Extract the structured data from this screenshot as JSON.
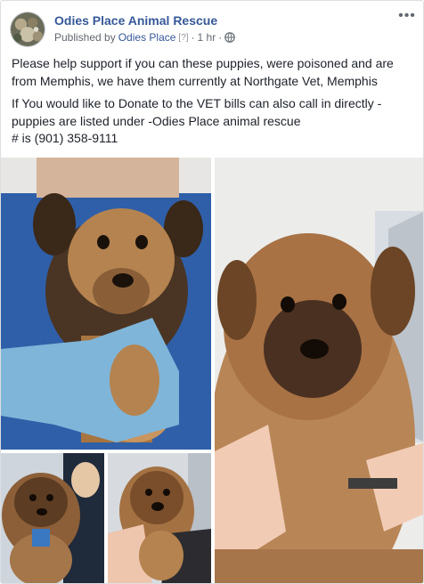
{
  "post": {
    "author": "Odies Place Animal Rescue",
    "published_by_prefix": "Published by",
    "published_by_name": "Odies Place",
    "help_marker": "[?]",
    "separator": "·",
    "timestamp": "1 hr",
    "more_icon": "more-options-icon",
    "privacy_icon": "globe-icon",
    "paragraphs": [
      "Please help support if you can these puppies, were poisoned and are from Memphis, we have them currently at Northgate Vet, Memphis",
      "If You would like to Donate to the VET bills can also call in directly - puppies are listed under -Odies Place animal rescue",
      "# is (901) 358-9111"
    ]
  },
  "colors": {
    "link": "#365899",
    "meta": "#616770",
    "text": "#1d2129",
    "border": "#dddfe2"
  }
}
